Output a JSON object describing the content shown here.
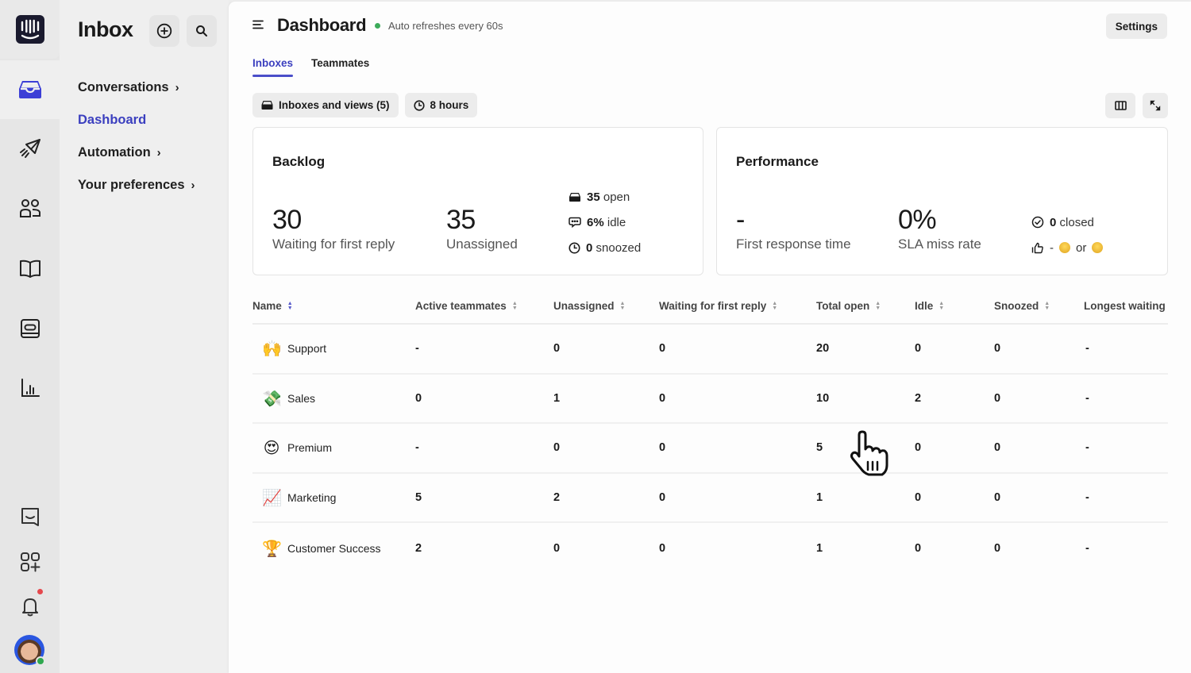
{
  "rail": {
    "items": [
      {
        "name": "logo",
        "icon": "intercom-logo-icon"
      },
      {
        "name": "inbox",
        "icon": "inbox-tray-icon",
        "active": true
      },
      {
        "name": "outbound",
        "icon": "paper-plane-icon"
      },
      {
        "name": "contacts",
        "icon": "people-icon"
      },
      {
        "name": "knowledge",
        "icon": "book-icon"
      },
      {
        "name": "tickets",
        "icon": "ticket-icon"
      },
      {
        "name": "reports",
        "icon": "bar-chart-icon"
      },
      {
        "name": "messenger",
        "icon": "chat-bubble-icon"
      },
      {
        "name": "apps",
        "icon": "apps-plus-icon"
      },
      {
        "name": "notifications",
        "icon": "bell-icon",
        "has_unread": true
      },
      {
        "name": "profile",
        "icon": "avatar-icon",
        "status": "online"
      }
    ]
  },
  "sidebar": {
    "title": "Inbox",
    "new_button_icon": "plus-circle-icon",
    "search_button_icon": "search-icon",
    "nav": [
      {
        "label": "Conversations",
        "chevron": "›",
        "active": false
      },
      {
        "label": "Dashboard",
        "chevron": "",
        "active": true
      },
      {
        "label": "Automation",
        "chevron": "›",
        "active": false
      },
      {
        "label": "Your preferences",
        "chevron": "›",
        "active": false
      }
    ]
  },
  "header": {
    "title": "Dashboard",
    "status_color": "#3dab5a",
    "subtitle": "Auto refreshes every 60s",
    "settings_label": "Settings"
  },
  "tabs": [
    {
      "label": "Inboxes",
      "active": true
    },
    {
      "label": "Teammates",
      "active": false
    }
  ],
  "filters": {
    "inboxes": "Inboxes and views (5)",
    "time_range": "8 hours"
  },
  "backlog": {
    "title": "Backlog",
    "waiting_value": "30",
    "waiting_label": "Waiting for first reply",
    "unassigned_value": "35",
    "unassigned_label": "Unassigned",
    "open_value": "35",
    "open_label": "open",
    "idle_value": "6%",
    "idle_label": "idle",
    "snoozed_value": "0",
    "snoozed_label": "snoozed"
  },
  "performance": {
    "title": "Performance",
    "frt_value": "-",
    "frt_label": "First response time",
    "sla_value": "0%",
    "sla_label": "SLA miss rate",
    "closed_value": "0",
    "closed_label": "closed",
    "csat_value": "-",
    "csat_or": "or"
  },
  "table": {
    "columns": [
      "Name",
      "Active teammates",
      "Unassigned",
      "Waiting for first reply",
      "Total open",
      "Idle",
      "Snoozed",
      "Longest waiting"
    ],
    "rows": [
      {
        "emoji": "🙌",
        "name": "Support",
        "active": "-",
        "unassigned": "0",
        "waiting": "0",
        "total_open": "20",
        "idle": "0",
        "snoozed": "0",
        "longest": "-"
      },
      {
        "emoji": "💸",
        "name": "Sales",
        "active": "0",
        "unassigned": "1",
        "waiting": "0",
        "total_open": "10",
        "idle": "2",
        "snoozed": "0",
        "longest": "-"
      },
      {
        "emoji": "😍",
        "name": "Premium",
        "active": "-",
        "unassigned": "0",
        "waiting": "0",
        "total_open": "5",
        "idle": "0",
        "snoozed": "0",
        "longest": "-"
      },
      {
        "emoji": "📈",
        "name": "Marketing",
        "active": "5",
        "unassigned": "2",
        "waiting": "0",
        "total_open": "1",
        "idle": "0",
        "snoozed": "0",
        "longest": "-"
      },
      {
        "emoji": "🏆",
        "name": "Customer Success",
        "active": "2",
        "unassigned": "0",
        "waiting": "0",
        "total_open": "1",
        "idle": "0",
        "snoozed": "0",
        "longest": "-"
      }
    ]
  }
}
